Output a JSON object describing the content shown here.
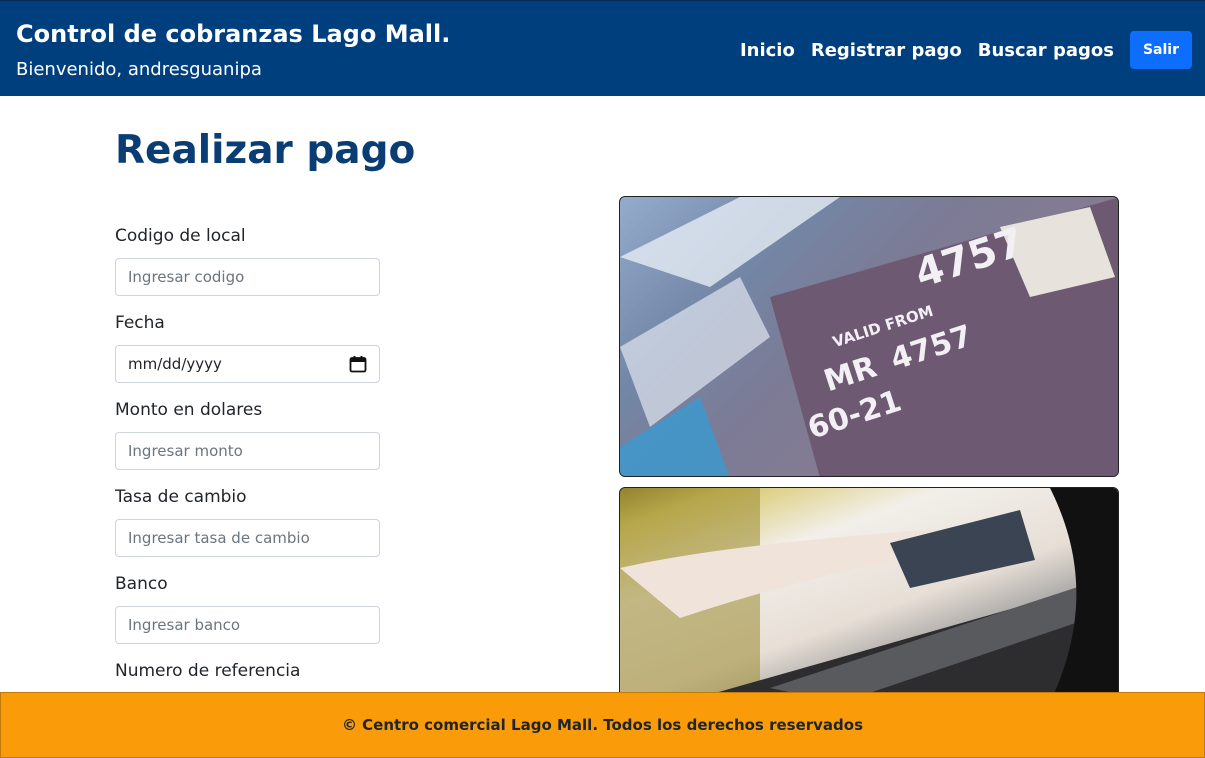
{
  "header": {
    "title": "Control de cobranzas Lago Mall.",
    "welcome": "Bienvenido, andresguanipa",
    "nav": [
      "Inicio",
      "Registrar pago",
      "Buscar pagos"
    ],
    "exit_label": "Salir"
  },
  "page": {
    "title": "Realizar pago"
  },
  "form": {
    "codigo": {
      "label": "Codigo de local",
      "placeholder": "Ingresar codigo"
    },
    "fecha": {
      "label": "Fecha",
      "value": "mm/dd/yyyy"
    },
    "monto": {
      "label": "Monto en dolares",
      "placeholder": "Ingresar monto"
    },
    "tasa": {
      "label": "Tasa de cambio",
      "placeholder": "Ingresar tasa de cambio"
    },
    "banco": {
      "label": "Banco",
      "placeholder": "Ingresar banco"
    },
    "referencia": {
      "label": "Numero de referencia"
    }
  },
  "images": {
    "card_text_1": "4757",
    "card_text_2": "VALID FROM",
    "card_text_3": "MR",
    "card_text_4": "4757",
    "card_text_5": "60-21"
  },
  "footer": {
    "text": "© Centro comercial Lago Mall. Todos los derechos reservados"
  },
  "colors": {
    "header": "#003f7d",
    "footer": "#fa9c0a",
    "title": "#0a3d73",
    "button": "#0d6efd"
  }
}
